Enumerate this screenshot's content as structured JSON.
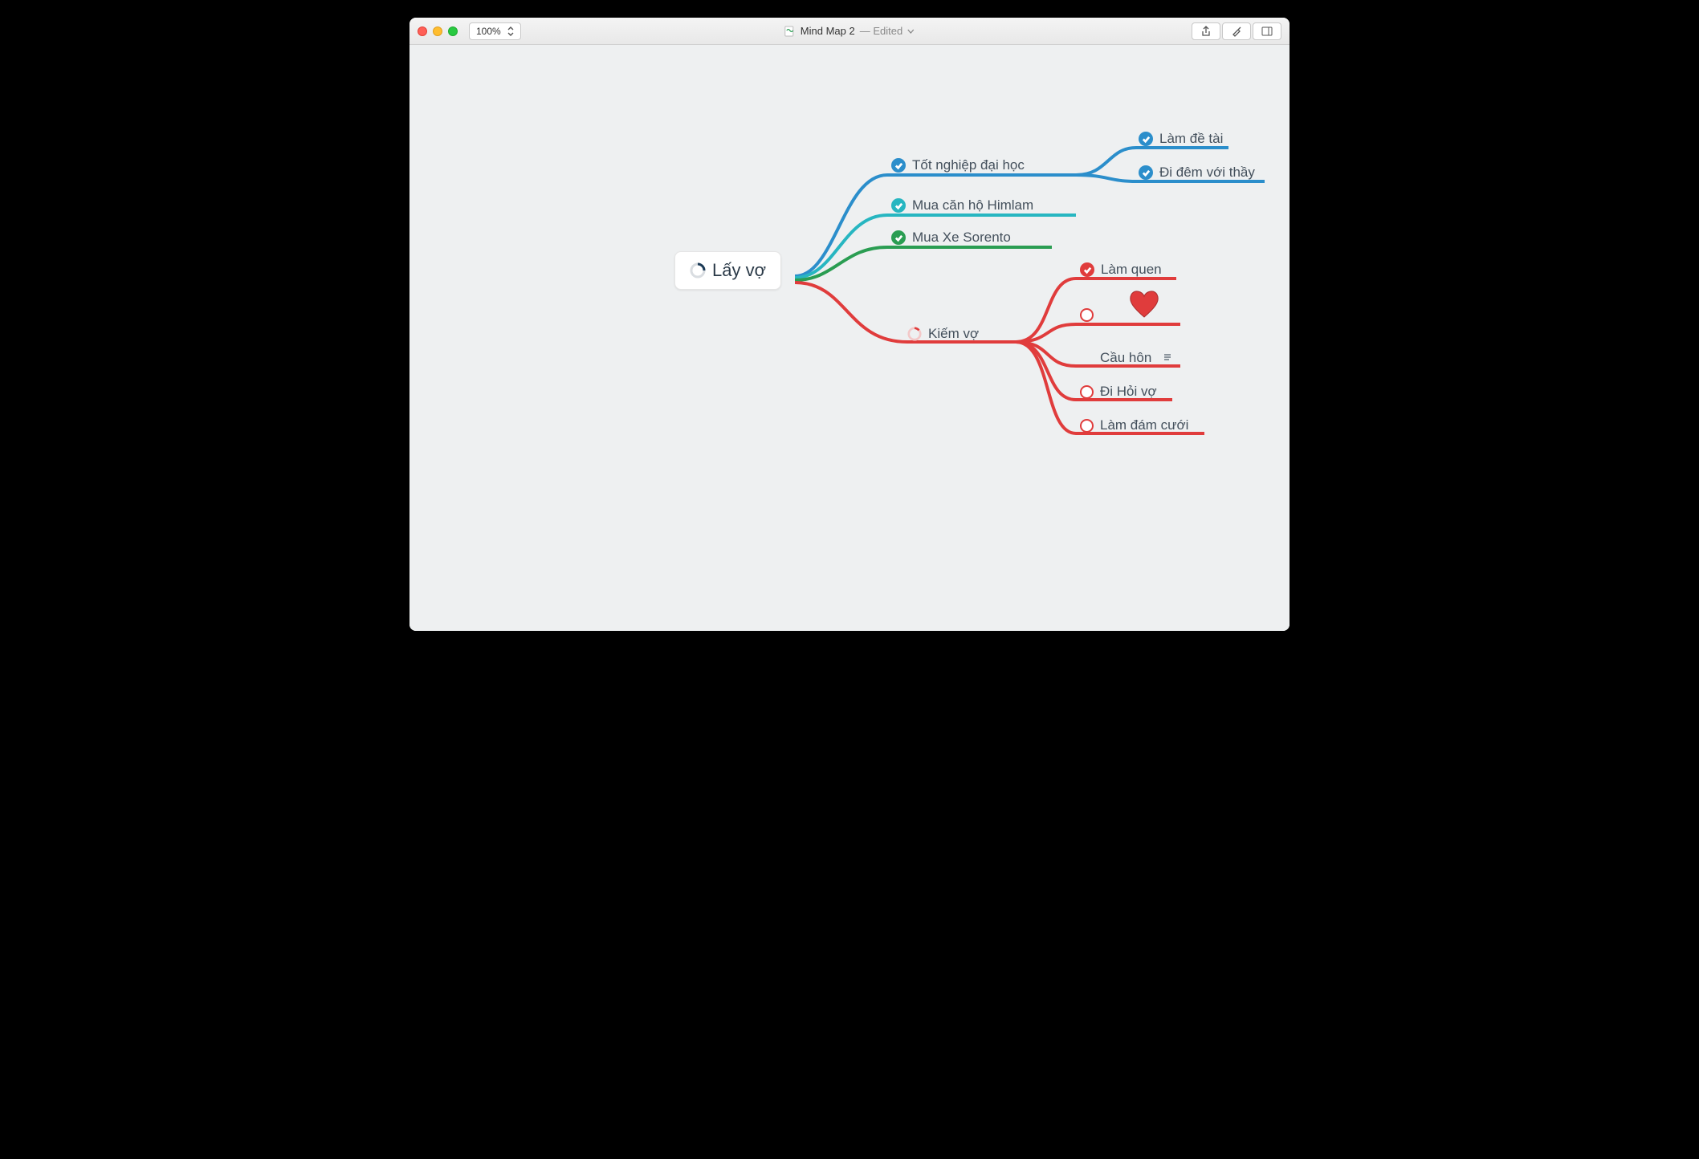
{
  "window": {
    "title": "Mind Map 2",
    "status": "Edited",
    "zoom": "100%"
  },
  "mindmap": {
    "root": {
      "text": "Lấy vợ"
    },
    "branches": [
      {
        "id": "b1",
        "text": "Tốt nghiệp đại học",
        "color": "#2b8ecb",
        "done": true,
        "children": [
          {
            "id": "b1c1",
            "text": "Làm đề tài",
            "done": true
          },
          {
            "id": "b1c2",
            "text": "Đi đêm với thầy",
            "done": true
          }
        ]
      },
      {
        "id": "b2",
        "text": "Mua căn hộ Himlam",
        "color": "#27b6c1",
        "done": true
      },
      {
        "id": "b3",
        "text": "Mua Xe Sorento",
        "color": "#2a9d52",
        "done": true
      },
      {
        "id": "b4",
        "text": "Kiếm vợ",
        "color": "#e03c3c",
        "done": false,
        "children": [
          {
            "id": "b4c1",
            "text": "Làm quen",
            "done": true
          },
          {
            "id": "b4c2",
            "text": "",
            "done": false,
            "icon": "heart"
          },
          {
            "id": "b4c3",
            "text": "Cầu hôn",
            "done": false,
            "note": true
          },
          {
            "id": "b4c4",
            "text": "Đi Hỏi vợ",
            "done": false
          },
          {
            "id": "b4c5",
            "text": "Làm đám cưới",
            "done": false
          }
        ]
      }
    ]
  },
  "colors": {
    "blue": "#2b8ecb",
    "teal": "#27b6c1",
    "green": "#2a9d52",
    "red": "#e03c3c",
    "navy": "#1b3a56"
  }
}
